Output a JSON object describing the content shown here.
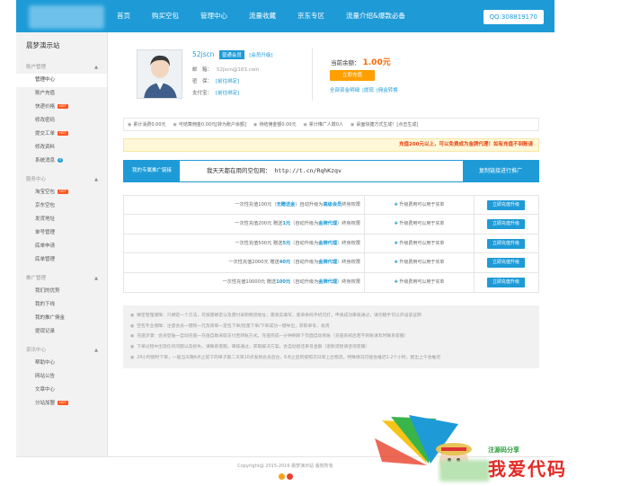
{
  "nav": {
    "items": [
      "首页",
      "购买空包",
      "管理中心",
      "流量收藏",
      "京东专区",
      "流量介绍&爆款必备"
    ],
    "qq": "QQ:308819170"
  },
  "sidebar": {
    "title": "晨梦演示站",
    "groups": [
      {
        "title": "账户管理",
        "items": [
          {
            "label": "管理中心",
            "badge": ""
          },
          {
            "label": "账户充值",
            "badge": ""
          },
          {
            "label": "快递价格",
            "badge": "HOT"
          },
          {
            "label": "修改密码",
            "badge": ""
          },
          {
            "label": "提交工单",
            "badge": "HOT"
          },
          {
            "label": "修改资料",
            "badge": ""
          },
          {
            "label": "系统消息",
            "badge": "0"
          }
        ]
      },
      {
        "title": "服务中心",
        "items": [
          {
            "label": "淘宝空包",
            "badge": "HOT"
          },
          {
            "label": "京东空包",
            "badge": ""
          },
          {
            "label": "发货地址",
            "badge": ""
          },
          {
            "label": "单号管理",
            "badge": ""
          },
          {
            "label": "底单申请",
            "badge": ""
          },
          {
            "label": "底单管理",
            "badge": ""
          }
        ]
      },
      {
        "title": "推广管理",
        "items": [
          {
            "label": "我们的优势",
            "badge": ""
          },
          {
            "label": "我的下线",
            "badge": ""
          },
          {
            "label": "我的推广佣金",
            "badge": ""
          },
          {
            "label": "提现记录",
            "badge": ""
          }
        ]
      },
      {
        "title": "资讯中心",
        "items": [
          {
            "label": "帮助中心",
            "badge": ""
          },
          {
            "label": "网站公告",
            "badge": ""
          },
          {
            "label": "文章中心",
            "badge": ""
          },
          {
            "label": "分站加盟",
            "badge": "HOT"
          }
        ]
      }
    ]
  },
  "profile": {
    "username": "52jscn",
    "level": "普通会员",
    "upgrade_link": "[会员升级]",
    "email_label": "邮　箱：",
    "email": "52jscn@163.com",
    "qq_label": "密　保：",
    "qq_link": "[前往绑定]",
    "alipay_label": "支付宝：",
    "alipay_link": "[前往绑定]"
  },
  "balance": {
    "label": "当前余额：",
    "amount": "1.00元",
    "recharge_button": "立即充值",
    "links": [
      "全部资金明细",
      "|提现",
      "|佣金转换"
    ]
  },
  "stats": [
    {
      "label": "累计消费0.00元"
    },
    {
      "label": "可结算佣金0.00元[转为账户余额]"
    },
    {
      "label": "待结佣金额0.00元"
    },
    {
      "label": "累计推广人数0人"
    },
    {
      "label": "桌面快捷方式生成！[点击生成]"
    }
  ],
  "promo": "充值200元以上，可以免费成为金牌代理！如有充值不到账请",
  "share": {
    "label": "我的专属推广链接",
    "text": "我天天都在用的空包网：",
    "url": "http://t.cn/RqhKzqv",
    "button": "复制链接进行推广"
  },
  "plans": [
    {
      "pre": "一次性充值100元（",
      "hl1": "无赠送金",
      "mid": "）自动升级为",
      "hl2": "高级会员",
      "post": "终身权限",
      "note": "升级费用可以用于买单",
      "button": "立即充值升级"
    },
    {
      "pre": "一次性充值200元 赠送",
      "hl1": "1元",
      "mid": "（自动升级为",
      "hl2": "金牌代理",
      "post": "）终身权限",
      "note": "升级费用可以用于买单",
      "button": "立即充值升级"
    },
    {
      "pre": "一次性充值500元 赠送",
      "hl1": "5元",
      "mid": "（自动升级为",
      "hl2": "金牌代理",
      "post": "）终身权限",
      "note": "升级费用可以用于买单",
      "button": "立即充值升级"
    },
    {
      "pre": "一次性充值2000元 赠送",
      "hl1": "40元",
      "mid": "（自动升级为",
      "hl2": "金牌代理",
      "post": "）终身权限",
      "note": "升级费用可以用于买单",
      "button": "立即充值升级"
    },
    {
      "pre": "一次性充值10000元 赠送",
      "hl1": "100元",
      "mid": "（自动升级为",
      "hl2": "金牌代理",
      "post": "）终身权限",
      "note": "升级费用可以用于买单",
      "button": "立即充值升级"
    }
  ],
  "notes": [
    "绑定管理保障：只绑定一个方法，可按需绑定以及需付采购物流地址；需真实填写，底单条码手机可打，申请成功审核通过，请勿随手可以开设该证明",
    "空包专业保障：注意会员一键购一元及简单一定包下单/批量下单/下单成功一键导出，获取单号，发货",
    "充值步骤：会员登陆一自动充值一充值自助采取支付宝转账方式，充值完成一分钟刷新下页面自动到账（充值系统后若不到账请及时联系客服）",
    "下单过程中出现任何问题以及损失，请联系客服，审核通过，获取解决方案，会自动退还单号金额（退款流程请咨询客服）",
    "24小时随时下单，一般当天晚6点之前下的单子第二天早10点发到会员后台，6点之后的按照次日早上出物流，特殊情况可能会推迟1-2个小时，配出上午会推迟"
  ],
  "footer": "Copyright@ 2015-2016 晨梦演示站 版权所有",
  "watermark": {
    "top": "注源码分享",
    "main": "我爱代码"
  }
}
